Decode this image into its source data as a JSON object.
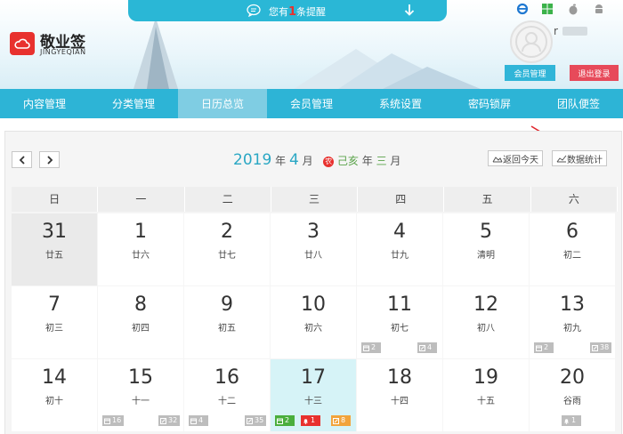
{
  "brand": {
    "name": "敬业签",
    "sub": "JINGYEQIAN"
  },
  "notice": {
    "prefix": "您有",
    "count": "1",
    "suffix": "条提醒"
  },
  "user": {
    "name": "r",
    "member_btn": "会员管理",
    "logout_btn": "退出登录"
  },
  "corner_icons": [
    "ie-icon",
    "windows-icon",
    "apple-icon",
    "android-icon"
  ],
  "nav": [
    {
      "label": "内容管理"
    },
    {
      "label": "分类管理"
    },
    {
      "label": "日历总览",
      "active": true
    },
    {
      "label": "会员管理"
    },
    {
      "label": "系统设置"
    },
    {
      "label": "密码锁屏"
    },
    {
      "label": "团队便签"
    }
  ],
  "calendar": {
    "year": "2019",
    "year_unit": "年",
    "month": "4",
    "month_unit": "月",
    "lunar_badge": "农",
    "lunar_year": "己亥",
    "lunar_year_unit": "年",
    "lunar_month": "三",
    "lunar_month_unit": "月",
    "back_today": "返回今天",
    "stats": "数据统计",
    "weekdays": [
      "日",
      "一",
      "二",
      "三",
      "四",
      "五",
      "六"
    ],
    "rows": [
      [
        {
          "day": "31",
          "lunar": "廿五",
          "other": true
        },
        {
          "day": "1",
          "lunar": "廿六"
        },
        {
          "day": "2",
          "lunar": "廿七"
        },
        {
          "day": "3",
          "lunar": "廿八"
        },
        {
          "day": "4",
          "lunar": "廿九"
        },
        {
          "day": "5",
          "lunar": "清明"
        },
        {
          "day": "6",
          "lunar": "初二"
        }
      ],
      [
        {
          "day": "7",
          "lunar": "初三"
        },
        {
          "day": "8",
          "lunar": "初四"
        },
        {
          "day": "9",
          "lunar": "初五"
        },
        {
          "day": "10",
          "lunar": "初六"
        },
        {
          "day": "11",
          "lunar": "初七",
          "badges": [
            {
              "type": "gray",
              "icon": "calendar-icon",
              "text": "2",
              "side": "left"
            },
            {
              "type": "gray",
              "icon": "edit-icon",
              "text": "4",
              "side": "right"
            }
          ]
        },
        {
          "day": "12",
          "lunar": "初八"
        },
        {
          "day": "13",
          "lunar": "初九",
          "badges": [
            {
              "type": "gray",
              "icon": "calendar-icon",
              "text": "2",
              "side": "left"
            },
            {
              "type": "gray",
              "icon": "edit-icon",
              "text": "38",
              "side": "right"
            }
          ]
        }
      ],
      [
        {
          "day": "14",
          "lunar": "初十"
        },
        {
          "day": "15",
          "lunar": "十一",
          "badges": [
            {
              "type": "gray",
              "icon": "calendar-icon",
              "text": "16",
              "side": "left"
            },
            {
              "type": "gray",
              "icon": "edit-icon",
              "text": "32",
              "side": "right"
            }
          ]
        },
        {
          "day": "16",
          "lunar": "十二",
          "badges": [
            {
              "type": "gray",
              "icon": "calendar-icon",
              "text": "4",
              "side": "left"
            },
            {
              "type": "gray",
              "icon": "edit-icon",
              "text": "35",
              "side": "right"
            }
          ]
        },
        {
          "day": "17",
          "lunar": "十三",
          "today": true,
          "badges": [
            {
              "type": "green",
              "icon": "calendar-icon",
              "text": "2",
              "side": "left"
            },
            {
              "type": "red",
              "icon": "bell-icon",
              "text": "1",
              "side": "mid"
            },
            {
              "type": "orange",
              "icon": "edit-icon",
              "text": "8",
              "side": "right"
            }
          ]
        },
        {
          "day": "18",
          "lunar": "十四"
        },
        {
          "day": "19",
          "lunar": "十五"
        },
        {
          "day": "20",
          "lunar": "谷雨",
          "badges": [
            {
              "type": "gray",
              "icon": "bell-icon",
              "text": "1",
              "side": "center"
            }
          ]
        }
      ]
    ]
  }
}
